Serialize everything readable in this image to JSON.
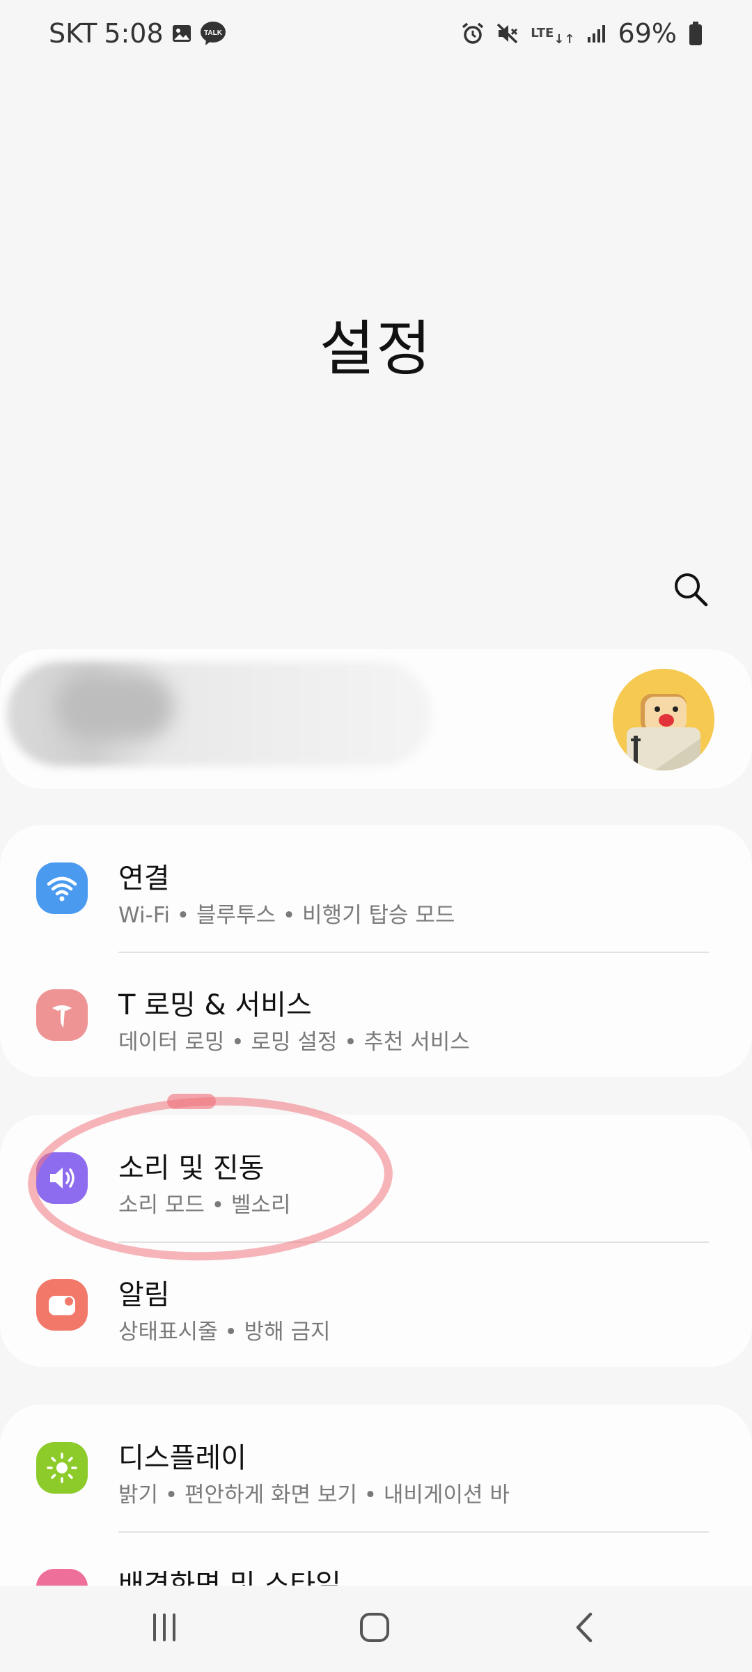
{
  "status_bar": {
    "carrier": "SKT",
    "time": "5:08",
    "left_icons": [
      "image-icon",
      "kakaotalk-icon"
    ],
    "kakaotalk_label": "TALK",
    "right_icons": [
      "alarm-icon",
      "mute-icon",
      "lte-icon",
      "signal-icon",
      "battery-icon"
    ],
    "network": "LTE",
    "battery": "69%"
  },
  "header": {
    "title": "설정",
    "search_icon": "search-icon"
  },
  "account": {
    "avatar_icon": "toast-avatar-icon"
  },
  "groups": [
    {
      "items": [
        {
          "name": "연결",
          "desc": "Wi-Fi  •  블루투스  •  비행기 탑승 모드",
          "icon": "wifi-icon",
          "color": "#4a9af0"
        },
        {
          "name": "T 로밍 & 서비스",
          "desc": "데이터 로밍  •  로밍 설정  •  추천 서비스",
          "icon": "t-service-icon",
          "color": "#ee9494"
        }
      ]
    },
    {
      "items": [
        {
          "name": "소리 및 진동",
          "desc": "소리 모드  •  벨소리",
          "icon": "speaker-icon",
          "color": "#8e6cf0"
        },
        {
          "name": "알림",
          "desc": "상태표시줄  •  방해 금지",
          "icon": "notification-icon",
          "color": "#f2786a"
        }
      ]
    },
    {
      "items": [
        {
          "name": "디스플레이",
          "desc": "밝기  •  편안하게 화면 보기  •  내비게이션 바",
          "icon": "brightness-icon",
          "color": "#8dcb2a"
        },
        {
          "name": "배경화면 및 스타일",
          "desc": "",
          "icon": "wallpaper-icon",
          "color": "#ee6f9a"
        }
      ]
    }
  ],
  "nav_bar": {
    "buttons": [
      "recent-apps-icon",
      "home-icon",
      "back-icon"
    ]
  }
}
